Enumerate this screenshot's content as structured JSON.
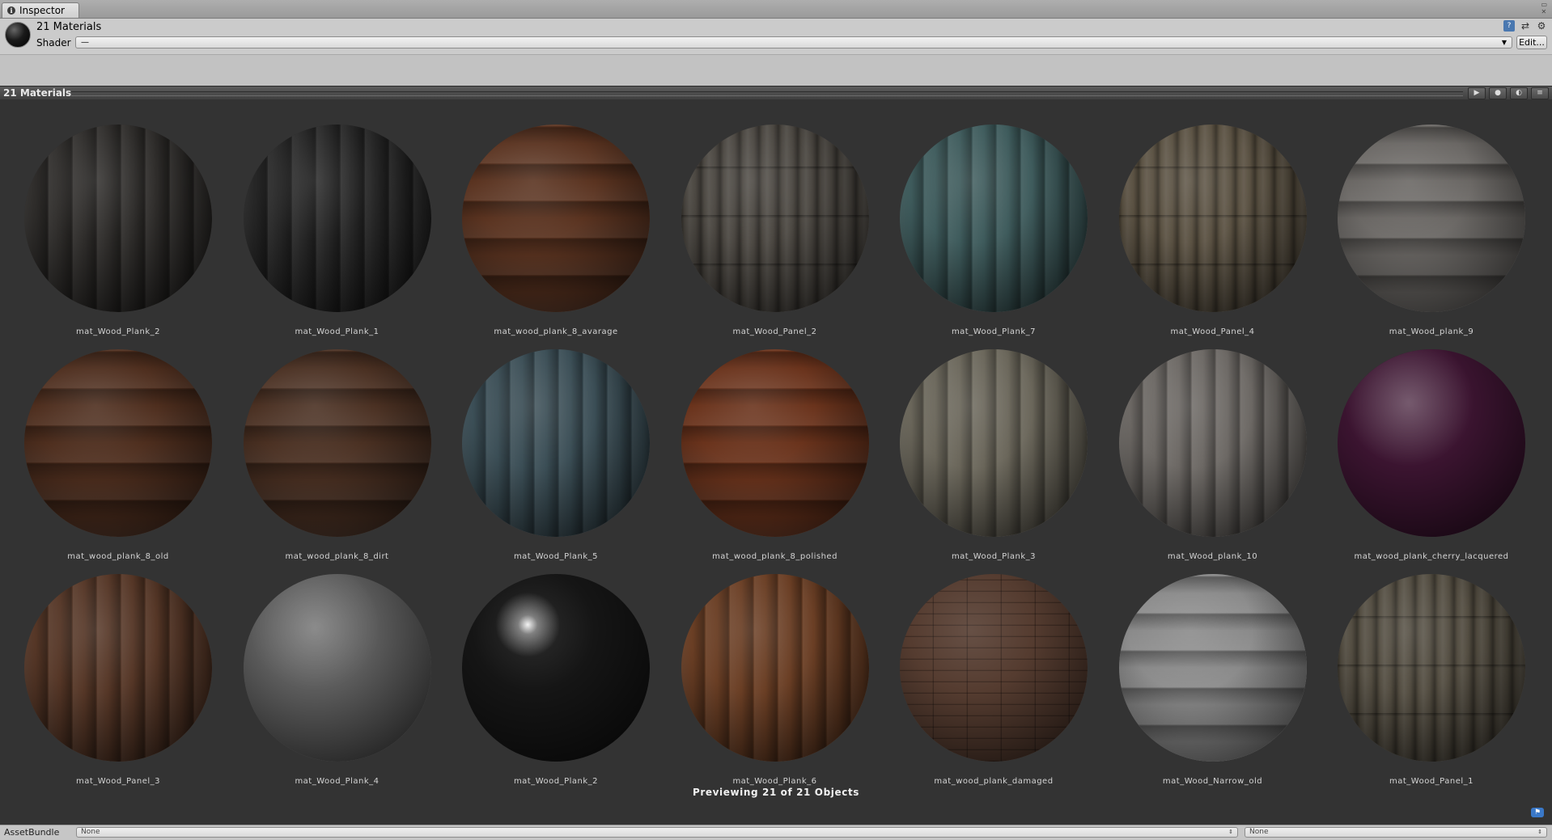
{
  "window": {
    "tab_label": "Inspector"
  },
  "header": {
    "title": "21 Materials",
    "shader_label": "Shader",
    "shader_value": "—",
    "edit_label": "Edit..."
  },
  "preview": {
    "title": "21 Materials",
    "footer": "Previewing 21 of 21 Objects",
    "materials": [
      {
        "name": "mat_Wood_Plank_2",
        "color": "#2e2c2a",
        "style": "vstripe"
      },
      {
        "name": "mat_Wood_Plank_1",
        "color": "#262626",
        "style": "vstripe"
      },
      {
        "name": "mat_wood_plank_8_avarage",
        "color": "#5a3320",
        "style": "hstripe"
      },
      {
        "name": "mat_Wood_Panel_2",
        "color": "#4a4640",
        "style": "panel"
      },
      {
        "name": "mat_Wood_Plank_7",
        "color": "#3e5b5c",
        "style": "vstripe"
      },
      {
        "name": "mat_Wood_Panel_4",
        "color": "#5a5142",
        "style": "panel"
      },
      {
        "name": "mat_Wood_plank_9",
        "color": "#6a6764",
        "style": "hstripe"
      },
      {
        "name": "mat_wood_plank_8_old",
        "color": "#4e2e1e",
        "style": "hstripe"
      },
      {
        "name": "mat_wood_plank_8_dirt",
        "color": "#4a3022",
        "style": "hstripe"
      },
      {
        "name": "mat_Wood_Plank_5",
        "color": "#3b4e56",
        "style": "vstripe"
      },
      {
        "name": "mat_wood_plank_8_polished",
        "color": "#6a331c",
        "style": "hstripe"
      },
      {
        "name": "mat_Wood_Plank_3",
        "color": "#6a665a",
        "style": "vstripe"
      },
      {
        "name": "mat_Wood_plank_10",
        "color": "#6c6864",
        "style": "vstripe"
      },
      {
        "name": "mat_wood_plank_cherry_lacquered",
        "color": "#3b1430",
        "style": "plain"
      },
      {
        "name": "mat_Wood_Panel_3",
        "color": "#553626",
        "style": "vstripe"
      },
      {
        "name": "mat_Wood_Plank_4",
        "color": "#5a5a5a",
        "style": "plain"
      },
      {
        "name": "mat_Wood_Plank_2",
        "color": "#151515",
        "style": "gloss"
      },
      {
        "name": "mat_Wood_Plank_6",
        "color": "#6a3e24",
        "style": "vstripe"
      },
      {
        "name": "mat_wood_plank_damaged",
        "color": "#553c30",
        "style": "brick"
      },
      {
        "name": "mat_Wood_Narrow_old",
        "color": "#8a8a8a",
        "style": "hstripe"
      },
      {
        "name": "mat_Wood_Panel_1",
        "color": "#524c40",
        "style": "panel"
      }
    ]
  },
  "asset_bundle": {
    "label": "AssetBundle",
    "bundle_value": "None",
    "variant_value": "None"
  }
}
